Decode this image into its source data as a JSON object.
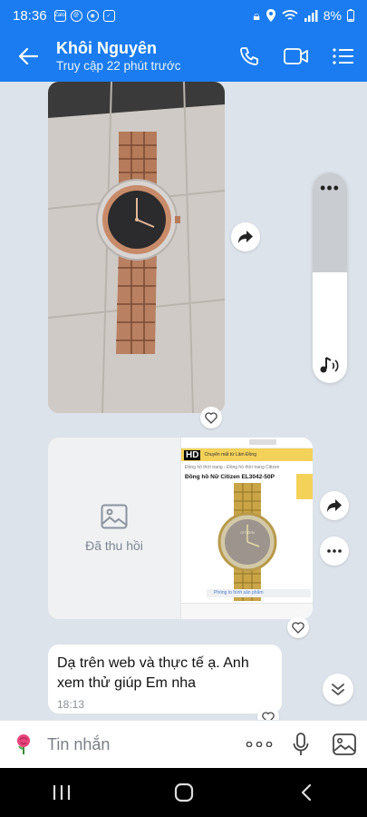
{
  "status_bar": {
    "time": "18:36",
    "battery": "8%"
  },
  "header": {
    "name": "Khôi Nguyên",
    "subtitle": "Truy cập 22 phút trước"
  },
  "messages": {
    "recalled_label": "Đã thu hồi",
    "screenshot": {
      "hd_badge": "HD",
      "top_link": "Chuyển mất từ Lâm Đồng",
      "breadcrumb": "Đồng hồ thời trang  ›  Đồng hồ thời trang Citizen",
      "product_title": "Đồng hồ Nữ Citizen EL3042-50P",
      "watch_brand": "CITIZEN",
      "footer_link": "Phóng to hình sản phẩm"
    },
    "text": "Dạ trên web và thực tế ạ. Anh xem thử giúp Em nha",
    "text_time": "18:13"
  },
  "composer": {
    "placeholder": "Tin nhắn"
  },
  "colors": {
    "brand": "#1a7cf0",
    "chat_bg": "#dde3ea"
  },
  "icons": [
    "back-arrow-icon",
    "phone-icon",
    "video-icon",
    "menu-icon",
    "share-icon",
    "heart-icon",
    "image-icon",
    "more-icon",
    "music-icon",
    "chevron-double-down-icon",
    "sticker-icon",
    "mic-icon",
    "gallery-icon",
    "recent-apps-icon",
    "home-icon",
    "nav-back-icon"
  ]
}
